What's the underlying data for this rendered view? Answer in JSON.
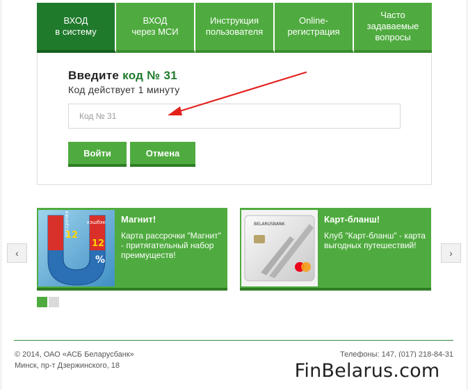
{
  "tabs": [
    {
      "line1": "ВХОД",
      "line2": "в систему",
      "active": true
    },
    {
      "line1": "ВХОД",
      "line2": "через МСИ",
      "active": false
    },
    {
      "line1": "Инструкция",
      "line2": "пользователя",
      "active": false
    },
    {
      "line1": "Online-",
      "line2": "регистрация",
      "active": false
    },
    {
      "line1": "Часто",
      "line2": "задаваемые",
      "line3": "вопросы",
      "active": false
    }
  ],
  "login": {
    "heading_prefix": "Введите",
    "heading_code": "код № 31",
    "subheading": "Код действует 1 минуту",
    "input_placeholder": "Код № 31",
    "input_value": "",
    "login_button": "Войти",
    "cancel_button": "Отмена"
  },
  "carousel": {
    "prev_icon": "‹",
    "next_icon": "›",
    "cards": [
      {
        "title": "Магнит!",
        "text": "Карта рассрочки \"Магнит\" - притягательный набор преимуществ!",
        "image_texts": [
          "рассрочка",
          "12",
          "12",
          "кэшбэк",
          "%"
        ]
      },
      {
        "title": "Карт-бланш!",
        "text": "Клуб \"Карт-бланш\" - карта выгодных путешествий!",
        "image_texts": [
          "BELARUSBANK"
        ]
      }
    ],
    "active_slide": 1,
    "slide_count": 2
  },
  "footer": {
    "copyright": "© 2014, ОАО «АСБ Беларусбанк»",
    "address": "Минск, пр-т Дзержинского, 18",
    "phones": "Телефоны: 147, (017) 218-84-31"
  },
  "watermark": "FinBelarus.com",
  "colors": {
    "accent_green": "#4fab3f",
    "dark_green": "#1f7a2c",
    "arrow_red": "#e3211c"
  },
  "icons": {
    "annotation": "red-arrow-icon",
    "prev": "chevron-left-icon",
    "next": "chevron-right-icon"
  }
}
